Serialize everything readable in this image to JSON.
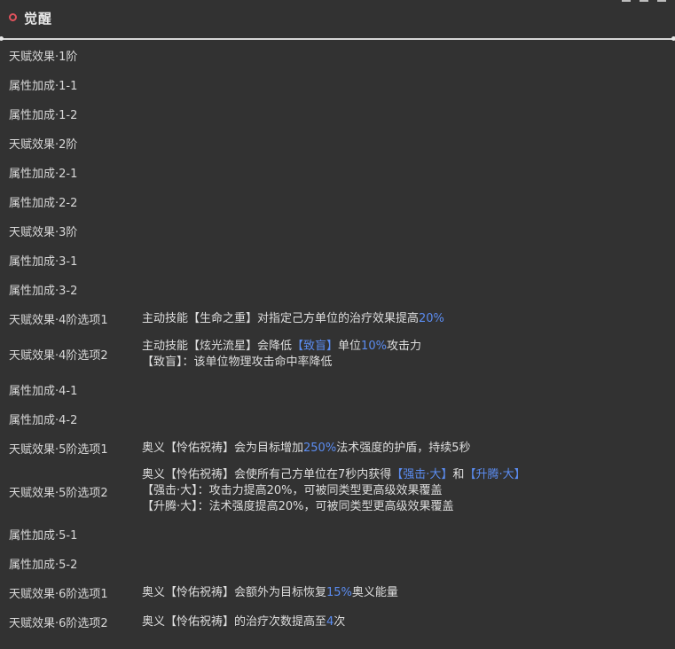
{
  "header": {
    "title": "觉醒",
    "icon": "ring-icon",
    "icon_color": "#e0525c"
  },
  "colors": {
    "background": "#323232",
    "text": "#dcdcdc",
    "highlight": "#5b8cf0"
  },
  "rows": [
    {
      "label": "天赋效果·1阶",
      "lines": []
    },
    {
      "label": "属性加成·1-1",
      "lines": []
    },
    {
      "label": "属性加成·1-2",
      "lines": []
    },
    {
      "label": "天赋效果·2阶",
      "lines": []
    },
    {
      "label": "属性加成·2-1",
      "lines": []
    },
    {
      "label": "属性加成·2-2",
      "lines": []
    },
    {
      "label": "天赋效果·3阶",
      "lines": []
    },
    {
      "label": "属性加成·3-1",
      "lines": []
    },
    {
      "label": "属性加成·3-2",
      "lines": []
    },
    {
      "label": "天赋效果·4阶选项1",
      "lines": [
        [
          {
            "t": "主动技能【生命之重】对指定己方单位的治疗效果提高"
          },
          {
            "t": "20%",
            "hl": true
          }
        ]
      ]
    },
    {
      "label": "天赋效果·4阶选项2",
      "lines": [
        [
          {
            "t": "主动技能【炫光流星】会降低"
          },
          {
            "t": "【致盲】",
            "hl": true
          },
          {
            "t": "单位"
          },
          {
            "t": "10%",
            "hl": true
          },
          {
            "t": "攻击力"
          }
        ],
        [
          {
            "t": "【致盲】：该单位物理攻击命中率降低"
          }
        ]
      ]
    },
    {
      "label": "属性加成·4-1",
      "lines": []
    },
    {
      "label": "属性加成·4-2",
      "lines": []
    },
    {
      "label": "天赋效果·5阶选项1",
      "lines": [
        [
          {
            "t": "奥义【怜佑祝祷】会为目标增加"
          },
          {
            "t": "250%",
            "hl": true
          },
          {
            "t": "法术强度的护盾，持续5秒"
          }
        ]
      ]
    },
    {
      "label": "天赋效果·5阶选项2",
      "lines": [
        [
          {
            "t": "奥义【怜佑祝祷】会使所有己方单位在7秒内获得"
          },
          {
            "t": "【强击·大】",
            "hl": true
          },
          {
            "t": "和"
          },
          {
            "t": "【升腾·大】",
            "hl": true
          }
        ],
        [
          {
            "t": "【强击·大】：攻击力提高20%，可被同类型更高级效果覆盖"
          }
        ],
        [
          {
            "t": "【升腾·大】：法术强度提高20%，可被同类型更高级效果覆盖"
          }
        ]
      ]
    },
    {
      "label": "属性加成·5-1",
      "lines": []
    },
    {
      "label": "属性加成·5-2",
      "lines": []
    },
    {
      "label": "天赋效果·6阶选项1",
      "lines": [
        [
          {
            "t": "奥义【怜佑祝祷】会额外为目标恢复"
          },
          {
            "t": "15%",
            "hl": true
          },
          {
            "t": "奥义能量"
          }
        ]
      ]
    },
    {
      "label": "天赋效果·6阶选项2",
      "lines": [
        [
          {
            "t": "奥义【怜佑祝祷】的治疗次数提高至"
          },
          {
            "t": "4",
            "hl": true
          },
          {
            "t": "次"
          }
        ]
      ]
    }
  ]
}
